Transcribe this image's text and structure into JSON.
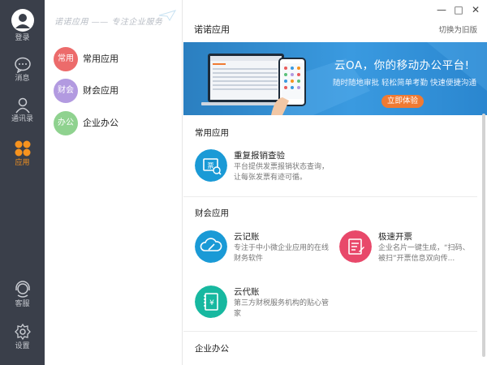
{
  "rail": {
    "login": "登录",
    "messages": "消息",
    "contacts": "通讯录",
    "apps": "应用",
    "service": "客服",
    "settings": "设置"
  },
  "catpanel": {
    "slogan": "诺诺应用 —— 专注企业服务",
    "items": [
      {
        "badge": "常用",
        "label": "常用应用",
        "color": "#ec6b6b"
      },
      {
        "badge": "财会",
        "label": "财会应用",
        "color": "#b29ae0"
      },
      {
        "badge": "办公",
        "label": "企业办公",
        "color": "#8fd28f"
      }
    ]
  },
  "header": {
    "title": "诺诺应用",
    "switch_old": "切换为旧版",
    "minimize": "—",
    "maximize": "□",
    "close": "✕"
  },
  "banner": {
    "title": "云OA，你的移动办公平台!",
    "subtitle": "随时随地审批 轻松简单考勤 快速便捷沟通",
    "cta": "立即体验"
  },
  "sections": {
    "common": "常用应用",
    "finance": "财会应用",
    "office": "企业办公"
  },
  "apps": {
    "dup_check": {
      "name": "重复报销查验",
      "desc": "平台提供发票报销状态查询，让每张发票有迹可循。",
      "color": "#1a9ad6"
    },
    "cloud_ledger": {
      "name": "云记账",
      "desc": "专注于中小微企业应用的在线财务软件",
      "color": "#1a9ad6"
    },
    "fast_invoice": {
      "name": "极速开票",
      "desc": "企业名片一键生成，“扫码、被扫”开票信息双向传...",
      "color": "#e8486a"
    },
    "cloud_agency": {
      "name": "云代账",
      "desc": "第三方财税服务机构的贴心管家",
      "color": "#17b8a0"
    }
  },
  "colors": {
    "rail_bg": "#3a3f4a",
    "accent_orange": "#f7931e",
    "banner_blue": "#3a9ae0"
  }
}
